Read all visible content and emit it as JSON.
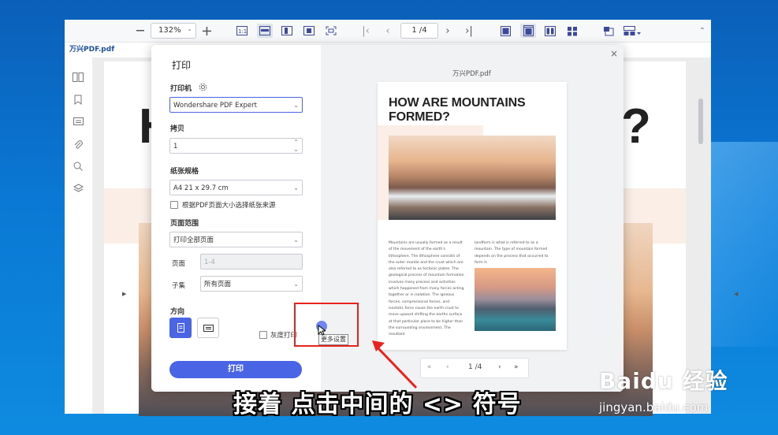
{
  "toolbar": {
    "zoom_value": "132%",
    "page_value": "1 /4",
    "icons": [
      "zoom-out-icon",
      "zoom-in-icon",
      "actual-size-icon",
      "fit-width-icon",
      "fit-page-icon",
      "fit-visible-icon",
      "fullscreen-icon",
      "first-page-icon",
      "prev-page-icon",
      "next-page-icon",
      "last-page-icon",
      "single-page-icon",
      "continuous-icon",
      "two-page-icon",
      "two-page-scroll-icon",
      "ocr-icon",
      "more-view-icon",
      "collapse-icon"
    ]
  },
  "document": {
    "tab_label": "万兴PDF.pdf",
    "bg_heading_left": "H",
    "bg_heading_right": "?"
  },
  "dialog": {
    "title": "打印",
    "printer_label": "打印机",
    "printer_value": "Wondershare PDF Expert",
    "copies_label": "拷贝",
    "copies_value": "1",
    "paper_label": "纸张规格",
    "paper_value": "A4 21 x 29.7 cm",
    "paper_source_checkbox": "根据PDF页面大小选择纸张来源",
    "range_label": "页面范围",
    "range_value": "打印全部页面",
    "pages_label": "页面",
    "pages_placeholder": "1-4",
    "subset_label": "子集",
    "subset_value": "所有页面",
    "orientation_label": "方向",
    "grayscale_label": "灰度打印",
    "print_button": "打印",
    "more_settings_tooltip": "更多设置"
  },
  "preview": {
    "filename": "万兴PDF.pdf",
    "page_title": "HOW ARE MOUNTAINS FORMED?",
    "col_left": "Mountains are usually formed as a result of the movement of the earth's lithosphere. The lithosphere consists of the outer mantle and the crust which are also referred to as tectonic plates. The geological process of mountain formation involves many process and activities which happened from many forces acting together or in isolation. The igneous forces, compressional forces, and isostatic force cause the earth crust to move upward shifting the earths surface at that particular place to be higher than the surrounding environment. The resultant",
    "col_right": "landform is what is referred to as a mountain. The type of mountain formed depends on the process that occurred to form it.",
    "pager_page": "1 /4",
    "first": "«",
    "prev": "‹",
    "next": "›",
    "last": "»"
  },
  "overlay": {
    "caption": "接着 点击中间的 <> 符号",
    "watermark": "Baidu 经验",
    "watermark_url": "jingyan.baidu.com",
    "highlight_color": "#e8231d"
  }
}
